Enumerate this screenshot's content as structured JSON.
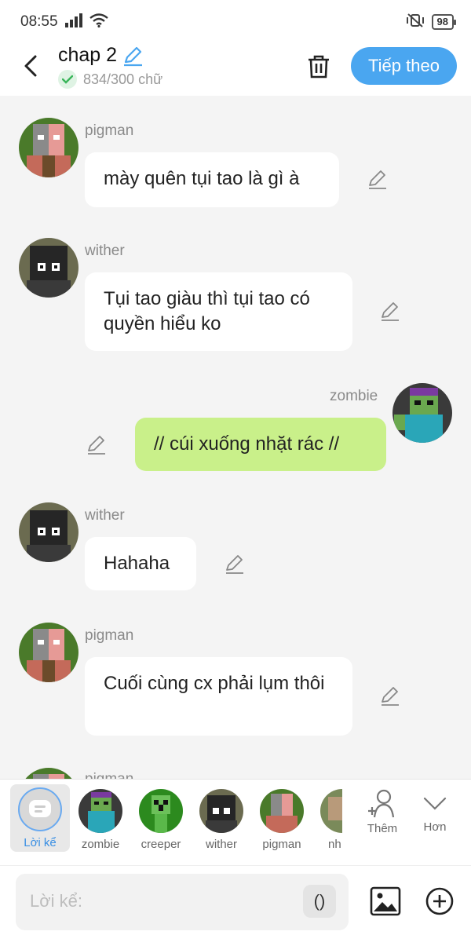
{
  "status_bar": {
    "time": "08:55",
    "battery": "98"
  },
  "header": {
    "title": "chap 2",
    "word_count": "834/300 chữ",
    "next_label": "Tiếp theo"
  },
  "messages": [
    {
      "name": "pigman",
      "text": "mày quên tụi tao là gì à",
      "side": "left",
      "avatar": "pigman"
    },
    {
      "name": "wither",
      "text": "Tụi tao giàu thì tụi tao có quyền hiểu ko",
      "side": "left",
      "avatar": "wither"
    },
    {
      "name": "zombie",
      "text": "// cúi xuống nhặt rác //",
      "side": "right",
      "avatar": "zombie"
    },
    {
      "name": "wither",
      "text": "Hahaha",
      "side": "left",
      "avatar": "wither"
    },
    {
      "name": "pigman",
      "text": "Cuối cùng cx phải lụm thôi",
      "side": "left",
      "avatar": "pigman"
    },
    {
      "name": "pigman",
      "text": "",
      "side": "left",
      "avatar": "pigman"
    }
  ],
  "characters": [
    {
      "label": "Lời kể",
      "selected": true
    },
    {
      "label": "zombie"
    },
    {
      "label": "creeper"
    },
    {
      "label": "wither"
    },
    {
      "label": "pigman"
    },
    {
      "label": "nh"
    }
  ],
  "actions": {
    "add_label": "Thêm",
    "more_label": "Hơn"
  },
  "input": {
    "placeholder": "Lời kể:",
    "paren": "()"
  },
  "colors": {
    "accent": "#4aa6f0",
    "my_bubble": "#c9f08a",
    "check": "#39b55a"
  }
}
